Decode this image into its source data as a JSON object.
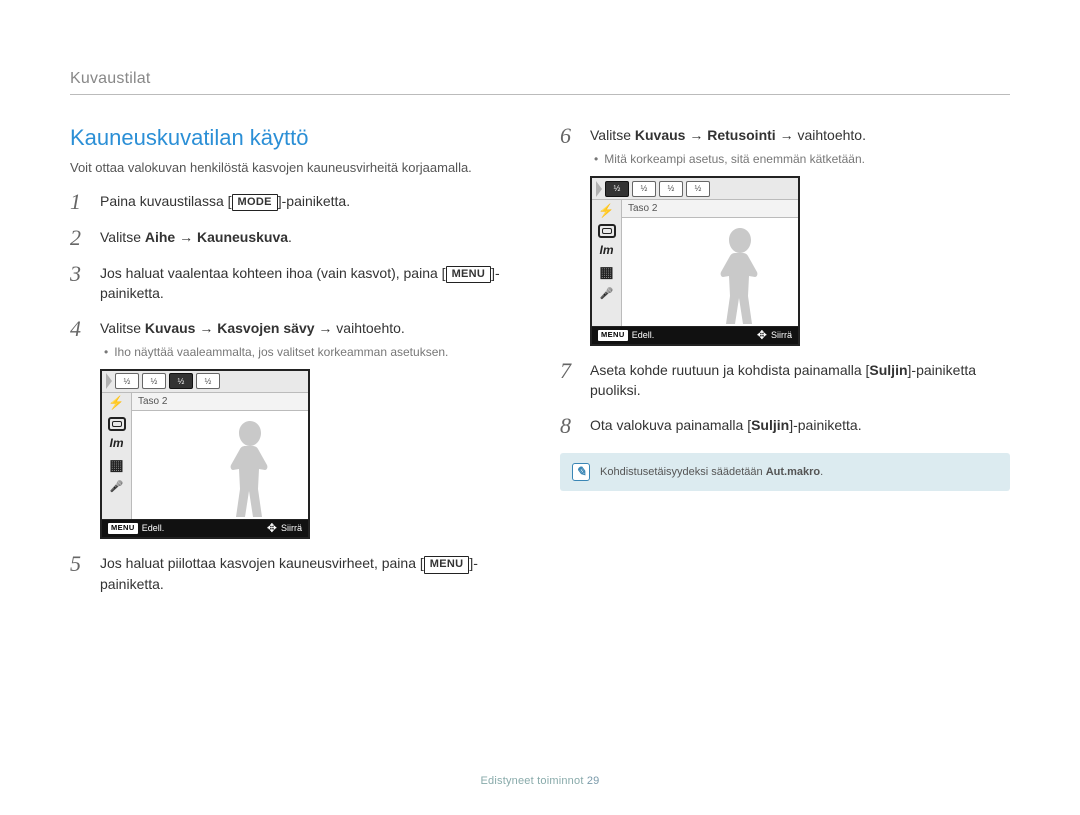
{
  "breadcrumb": "Kuvaustilat",
  "heading": "Kauneuskuvatilan käyttö",
  "intro": "Voit ottaa valokuvan henkilöstä kasvojen kauneusvirheitä korjaamalla.",
  "keys": {
    "mode": "MODE",
    "menu": "MENU"
  },
  "steps_left": {
    "s1": {
      "pre": "Paina kuvaustilassa [",
      "post": "]-painiketta."
    },
    "s2": {
      "pre": "Valitse ",
      "b1": "Aihe",
      "arrow": " → ",
      "b2": "Kauneuskuva",
      "post": "."
    },
    "s3": {
      "pre": "Jos haluat vaalentaa kohteen ihoa (vain kasvot), paina [",
      "post": "]-painiketta."
    },
    "s4": {
      "pre": "Valitse ",
      "b1": "Kuvaus",
      "arrow1": " → ",
      "b2": "Kasvojen sävy",
      "arrow2": " → vaihtoehto.",
      "sub": "Iho näyttää vaaleammalta, jos valitset korkeamman asetuksen."
    },
    "s5": {
      "pre": "Jos haluat piilottaa kasvojen kauneusvirheet, paina [",
      "post": "]-painiketta."
    }
  },
  "steps_right": {
    "s6": {
      "pre": "Valitse ",
      "b1": "Kuvaus",
      "arrow1": " → ",
      "b2": "Retusointi",
      "arrow2": " → vaihtoehto.",
      "sub": "Mitä korkeampi asetus, sitä enemmän kätketään."
    },
    "s7": {
      "pre": "Aseta kohde ruutuun ja kohdista painamalla [",
      "b": "Suljin",
      "post": "]-painiketta puoliksi."
    },
    "s8": {
      "pre": "Ota valokuva painamalla [",
      "b": "Suljin",
      "post": "]-painiketta."
    }
  },
  "lcd": {
    "chip1": "½",
    "chip2": "½",
    "chip3": "½",
    "chip4": "½",
    "selected": "Taso 2",
    "im": "Im",
    "menu_label": "MENU",
    "back": "Edell.",
    "move": "Siirrä"
  },
  "note": {
    "pre": "Kohdistusetäisyydeksi säädetään ",
    "bold": "Aut.makro",
    "post": "."
  },
  "footer": {
    "section": "Edistyneet toiminnot",
    "page": "29"
  }
}
